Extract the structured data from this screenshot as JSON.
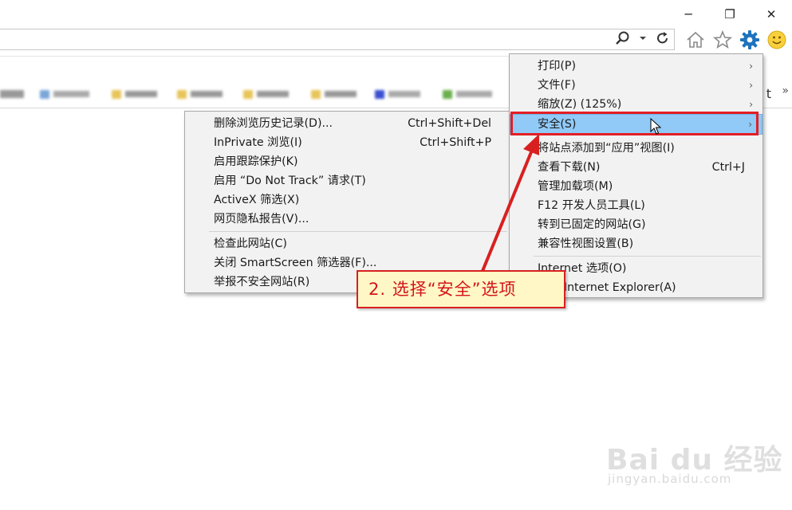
{
  "window": {
    "minimize": "─",
    "restore": "❐",
    "close": "✕"
  },
  "toolbar": {
    "icons": [
      "search-icon",
      "refresh-icon",
      "home-icon",
      "favorites-star-icon",
      "tools-gear-icon",
      "feedback-smiley-icon"
    ],
    "accent": "#1e73be"
  },
  "favorites_bar": {
    "overflow": "»",
    "edge_char": "t"
  },
  "main_menu": {
    "items": [
      {
        "label": "打印(P)",
        "shortcut": "",
        "arrow": "›"
      },
      {
        "label": "文件(F)",
        "shortcut": "",
        "arrow": "›"
      },
      {
        "label": "缩放(Z) (125%)",
        "shortcut": "",
        "arrow": "›"
      },
      {
        "label": "安全(S)",
        "shortcut": "",
        "arrow": "›"
      },
      {
        "label": "将站点添加到“应用”视图(I)",
        "shortcut": ""
      },
      {
        "label": "查看下载(N)",
        "shortcut": "Ctrl+J"
      },
      {
        "label": "管理加载项(M)",
        "shortcut": ""
      },
      {
        "label": "F12 开发人员工具(L)",
        "shortcut": ""
      },
      {
        "label": "转到已固定的网站(G)",
        "shortcut": ""
      },
      {
        "label": "兼容性视图设置(B)",
        "shortcut": ""
      },
      {
        "label": "Internet 选项(O)",
        "shortcut": ""
      },
      {
        "label": "关于 Internet Explorer(A)",
        "shortcut": ""
      }
    ]
  },
  "safety_submenu": {
    "items": [
      {
        "label": "删除浏览历史记录(D)...",
        "shortcut": "Ctrl+Shift+Del"
      },
      {
        "label": "InPrivate 浏览(I)",
        "shortcut": "Ctrl+Shift+P"
      },
      {
        "label": "启用跟踪保护(K)",
        "shortcut": ""
      },
      {
        "label": "启用 “Do Not Track” 请求(T)",
        "shortcut": ""
      },
      {
        "label": "ActiveX 筛选(X)",
        "shortcut": ""
      },
      {
        "label": "网页隐私报告(V)...",
        "shortcut": ""
      },
      {
        "label": "检查此网站(C)",
        "shortcut": ""
      },
      {
        "label": "关闭 SmartScreen 筛选器(F)...",
        "shortcut": ""
      },
      {
        "label": "举报不安全网站(R)",
        "shortcut": ""
      }
    ]
  },
  "annotation": {
    "callout_text": "2. 选择“安全”选项",
    "color": "#d92020"
  },
  "watermark": {
    "brand": "Bai du 经验",
    "url": "jingyan.baidu.com"
  }
}
